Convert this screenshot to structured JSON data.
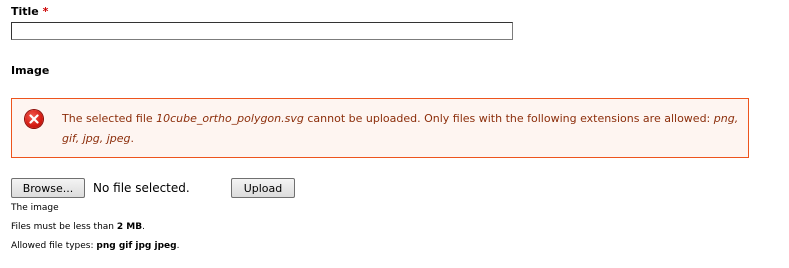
{
  "title_field": {
    "label": "Title",
    "required_marker": "*",
    "value": ""
  },
  "image_field": {
    "label": "Image"
  },
  "error": {
    "icon": "error-icon",
    "text_before": "The selected file ",
    "filename": "10cube_ortho_polygon.svg",
    "text_middle": " cannot be uploaded. Only files with the following extensions are allowed: ",
    "extensions": "png, gif, jpg, jpeg",
    "text_after": "."
  },
  "file_picker": {
    "browse_label": "Browse...",
    "status": "No file selected.",
    "upload_label": "Upload"
  },
  "help": {
    "description": "The image",
    "size_prefix": "Files must be less than ",
    "size_value": "2 MB",
    "size_suffix": ".",
    "types_prefix": "Allowed file types: ",
    "types_value": "png gif jpg jpeg",
    "types_suffix": "."
  },
  "colors": {
    "error_border": "#ed541d",
    "error_background": "#fef5f1",
    "error_text": "#8c2e0b",
    "required_marker": "#cc0000"
  }
}
